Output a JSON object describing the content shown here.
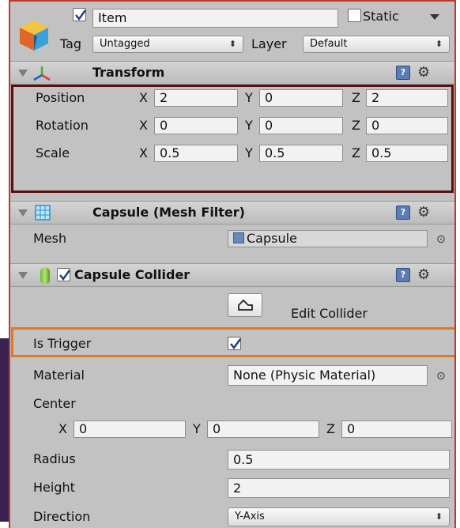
{
  "object": {
    "name": "Item",
    "active_checked": true,
    "static_label": "Static",
    "static_checked": false,
    "tag_label": "Tag",
    "tag_value": "Untagged",
    "layer_label": "Layer",
    "layer_value": "Default"
  },
  "transform": {
    "title": "Transform",
    "rows": [
      {
        "label": "Position",
        "x": "2",
        "y": "0",
        "z": "2"
      },
      {
        "label": "Rotation",
        "x": "0",
        "y": "0",
        "z": "0"
      },
      {
        "label": "Scale",
        "x": "0.5",
        "y": "0.5",
        "z": "0.5"
      }
    ],
    "axes": {
      "x": "X",
      "y": "Y",
      "z": "Z"
    }
  },
  "mesh_filter": {
    "title": "Capsule (Mesh Filter)",
    "mesh_label": "Mesh",
    "mesh_value": "Capsule"
  },
  "capsule_collider": {
    "title": "Capsule Collider",
    "enabled": true,
    "edit_collider_label": "Edit Collider",
    "is_trigger_label": "Is Trigger",
    "is_trigger_checked": true,
    "material_label": "Material",
    "material_value": "None (Physic Material)",
    "center_label": "Center",
    "center": {
      "x": "0",
      "y": "0",
      "z": "0"
    },
    "radius_label": "Radius",
    "radius_value": "0.5",
    "height_label": "Height",
    "height_value": "2",
    "direction_label": "Direction",
    "direction_value": "Y-Axis"
  },
  "highlight_colors": {
    "panel_border": "#c0392b",
    "transform_border": "#5a1010",
    "is_trigger_border": "#e07a1f"
  }
}
